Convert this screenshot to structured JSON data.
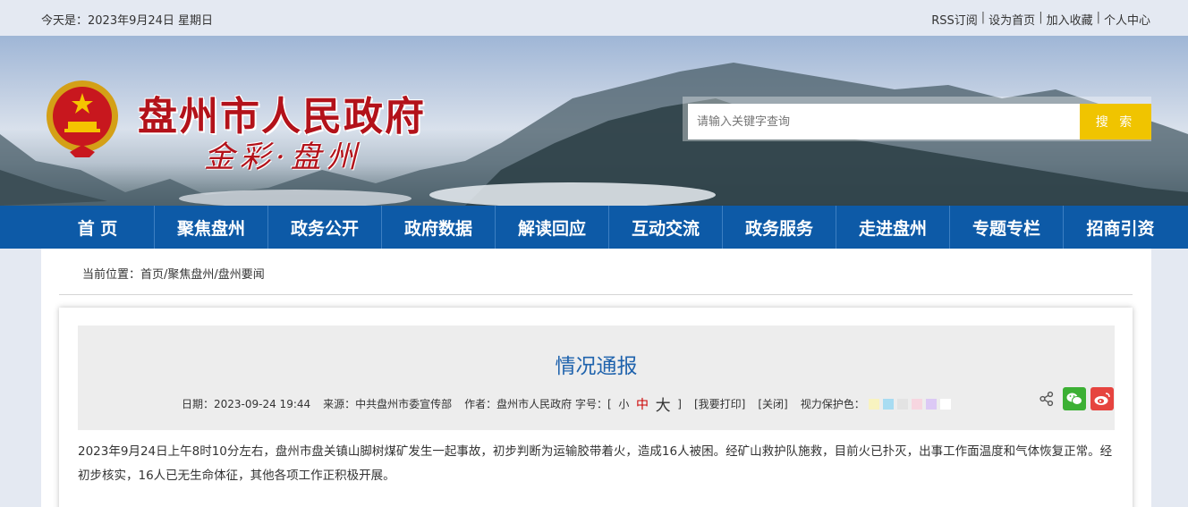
{
  "topbar": {
    "date": "今天是：2023年9月24日 星期日",
    "links": [
      "RSS订阅",
      "设为首页",
      "加入收藏",
      "个人中心"
    ]
  },
  "header": {
    "site_title": "盘州市人民政府",
    "slogan": "金彩·盘州",
    "search_placeholder": "请输入关键字查询",
    "search_button": "搜 索",
    "colors": {
      "title_red": "#b3121a",
      "search_button": "#f0c400"
    }
  },
  "nav": {
    "items": [
      "首 页",
      "聚焦盘州",
      "政务公开",
      "政府数据",
      "解读回应",
      "互动交流",
      "政务服务",
      "走进盘州",
      "专题专栏",
      "招商引资"
    ],
    "color": "#0d5aa7"
  },
  "breadcrumb": "当前位置：首页/聚焦盘州/盘州要闻",
  "article": {
    "title": "情况通报",
    "date": "日期：2023-09-24 19:44",
    "source": "来源：中共盘州市委宣传部",
    "author": "作者：盘州市人民政府",
    "fontsize_label": "字号：[",
    "fontsize_small": "小",
    "fontsize_medium": "中",
    "fontsize_large": "大",
    "fontsize_close": "]",
    "print": "[我要打印]",
    "close": "[关闭]",
    "eye_care": "视力保护色：",
    "eye_colors": [
      "#f8f3c0",
      "#a8dcf2",
      "#e3e3e3",
      "#f7d6e0",
      "#dcc9f5",
      "#ffffff"
    ],
    "share_icons": [
      "share-icon",
      "wechat-icon",
      "weibo-icon"
    ],
    "body": "2023年9月24日上午8时10分左右，盘州市盘关镇山脚树煤矿发生一起事故，初步判断为运输胶带着火，造成16人被困。经矿山救护队施救，目前火已扑灭，出事工作面温度和气体恢复正常。经初步核实，16人已无生命体征，其他各项工作正积极开展。"
  }
}
